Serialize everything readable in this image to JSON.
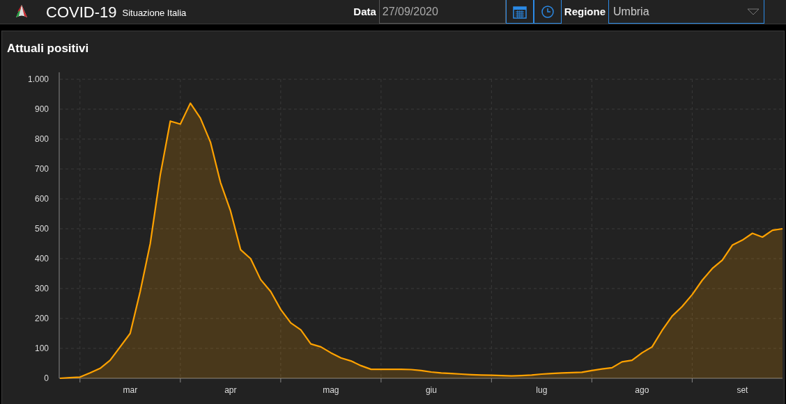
{
  "header": {
    "title": "COVID-19",
    "subtitle": "Situazione Italia"
  },
  "filters": {
    "date_label": "Data",
    "date_value": "27/09/2020",
    "region_label": "Regione",
    "region_value": "Umbria"
  },
  "panel": {
    "title": "Attuali positivi",
    "chart_data": {
      "type": "area",
      "grid": true,
      "ylim": [
        0,
        1000
      ],
      "categories": [
        null,
        null,
        null,
        null,
        null,
        null,
        null,
        "mar",
        null,
        null,
        null,
        null,
        null,
        null,
        null,
        null,
        null,
        "apr",
        null,
        null,
        null,
        null,
        null,
        null,
        null,
        null,
        null,
        "mag",
        null,
        null,
        null,
        null,
        null,
        null,
        null,
        null,
        null,
        "giu",
        null,
        null,
        null,
        null,
        null,
        null,
        null,
        null,
        null,
        null,
        "lug",
        null,
        null,
        null,
        null,
        null,
        null,
        null,
        null,
        null,
        "ago",
        null,
        null,
        null,
        null,
        null,
        null,
        null,
        null,
        null,
        "set",
        null,
        null,
        null,
        null
      ],
      "series": [
        {
          "color": "#ffa200",
          "values": [
            0,
            2,
            4,
            18,
            33,
            60,
            105,
            150,
            290,
            450,
            680,
            860,
            850,
            920,
            870,
            790,
            655,
            560,
            430,
            400,
            330,
            290,
            230,
            185,
            162,
            115,
            105,
            85,
            68,
            58,
            42,
            30,
            30,
            30,
            30,
            29,
            26,
            21,
            18,
            16,
            14,
            12,
            11,
            10,
            9,
            8,
            9,
            11,
            14,
            16,
            18,
            19,
            20,
            26,
            31,
            35,
            55,
            60,
            85,
            105,
            160,
            208,
            240,
            280,
            328,
            367,
            395,
            445,
            462,
            485,
            472,
            495,
            500
          ]
        }
      ],
      "yticks": [
        0,
        100,
        200,
        300,
        400,
        500,
        600,
        700,
        800,
        900,
        {
          "value": 1000,
          "label": "1.000"
        }
      ]
    }
  }
}
